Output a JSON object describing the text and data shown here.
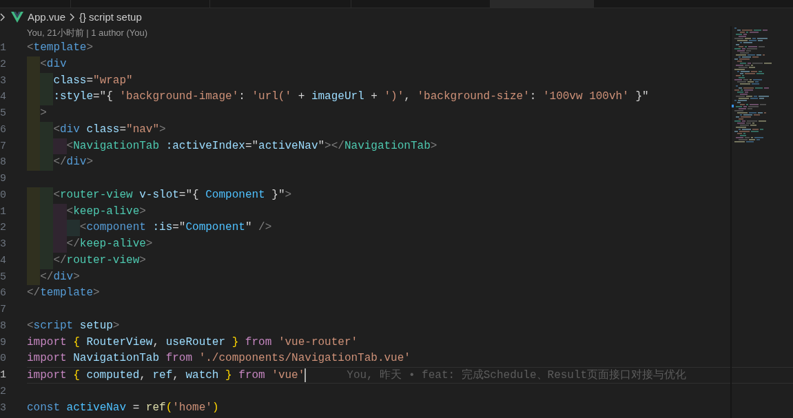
{
  "tabs": [
    {
      "selected": false
    },
    {
      "selected": false
    },
    {
      "selected": false
    },
    {
      "selected": false
    },
    {
      "selected": true
    }
  ],
  "breadcrumb": [
    {
      "kind": "file",
      "label": "App.vue"
    },
    {
      "kind": "symbol",
      "icon": "{}",
      "label": "script setup"
    }
  ],
  "codelens": "You, 21小时前 | 1 author (You)",
  "lines": [
    {
      "number": "1",
      "current": false,
      "tokens": [
        {
          "kind": "p",
          "text": "<"
        },
        {
          "kind": "tag",
          "text": "template"
        },
        {
          "kind": "p",
          "text": ">"
        }
      ],
      "children": [
        {
          "number": "2",
          "current": false,
          "tokens": [
            {
              "kind": "p",
              "text": "<"
            },
            {
              "kind": "tag",
              "text": "div"
            }
          ],
          "children": [
            {
              "number": "3",
              "current": false,
              "tokens": [
                {
                  "kind": "attr",
                  "text": "class"
                },
                {
                  "kind": "op",
                  "text": "="
                },
                {
                  "kind": "str",
                  "text": "\"wrap\""
                }
              ]
            },
            {
              "number": "4",
              "current": false,
              "tokens": [
                {
                  "kind": "attr",
                  "text": ":style"
                },
                {
                  "kind": "op",
                  "text": "=\"{ "
                },
                {
                  "kind": "str",
                  "text": "'background-image'"
                },
                {
                  "kind": "op",
                  "text": ": "
                },
                {
                  "kind": "str",
                  "text": "'url('"
                },
                {
                  "kind": "op",
                  "text": " + "
                },
                {
                  "kind": "var",
                  "text": "imageUrl"
                },
                {
                  "kind": "op",
                  "text": " + "
                },
                {
                  "kind": "str",
                  "text": "')'"
                },
                {
                  "kind": "op",
                  "text": ", "
                },
                {
                  "kind": "str",
                  "text": "'background-size'"
                },
                {
                  "kind": "op",
                  "text": ": "
                },
                {
                  "kind": "str",
                  "text": "'100vw 100vh'"
                },
                {
                  "kind": "op",
                  "text": " }\""
                }
              ]
            }
          ]
        },
        {
          "number": "5",
          "current": false,
          "tokens": [
            {
              "kind": "p",
              "text": ">"
            }
          ],
          "children": [
            {
              "number": "6",
              "current": false,
              "tokens": [
                {
                  "kind": "p",
                  "text": "<"
                },
                {
                  "kind": "tag",
                  "text": "div"
                },
                {
                  "kind": "attr",
                  "text": " class"
                },
                {
                  "kind": "op",
                  "text": "="
                },
                {
                  "kind": "str",
                  "text": "\"nav\""
                },
                {
                  "kind": "p",
                  "text": ">"
                }
              ],
              "children": [
                {
                  "number": "7",
                  "current": false,
                  "tokens": [
                    {
                      "kind": "p",
                      "text": "<"
                    },
                    {
                      "kind": "comp",
                      "text": "NavigationTab"
                    },
                    {
                      "kind": "attr",
                      "text": " :activeIndex"
                    },
                    {
                      "kind": "op",
                      "text": "=\""
                    },
                    {
                      "kind": "var",
                      "text": "activeNav"
                    },
                    {
                      "kind": "op",
                      "text": "\""
                    },
                    {
                      "kind": "p",
                      "text": "></"
                    },
                    {
                      "kind": "comp",
                      "text": "NavigationTab"
                    },
                    {
                      "kind": "p",
                      "text": ">"
                    }
                  ]
                }
              ]
            },
            {
              "number": "8",
              "current": false,
              "tokens": [
                {
                  "kind": "p",
                  "text": "</"
                },
                {
                  "kind": "tag",
                  "text": "div"
                },
                {
                  "kind": "p",
                  "text": ">"
                }
              ]
            },
            {
              "number": "9",
              "current": false
            },
            {
              "number": "0",
              "current": false,
              "tokens": [
                {
                  "kind": "p",
                  "text": "<"
                },
                {
                  "kind": "comp",
                  "text": "router-view"
                },
                {
                  "kind": "attr",
                  "text": " v-slot"
                },
                {
                  "kind": "op",
                  "text": "=\"{ "
                },
                {
                  "kind": "cls",
                  "text": "Component"
                },
                {
                  "kind": "op",
                  "text": " }\""
                },
                {
                  "kind": "p",
                  "text": ">"
                }
              ],
              "children": [
                {
                  "number": "1",
                  "current": false,
                  "tokens": [
                    {
                      "kind": "p",
                      "text": "<"
                    },
                    {
                      "kind": "comp",
                      "text": "keep-alive"
                    },
                    {
                      "kind": "p",
                      "text": ">"
                    }
                  ],
                  "children": [
                    {
                      "number": "2",
                      "current": false,
                      "tokens": [
                        {
                          "kind": "p",
                          "text": "<"
                        },
                        {
                          "kind": "tag",
                          "text": "component"
                        },
                        {
                          "kind": "attr",
                          "text": " :is"
                        },
                        {
                          "kind": "op",
                          "text": "=\""
                        },
                        {
                          "kind": "cls",
                          "text": "Component"
                        },
                        {
                          "kind": "op",
                          "text": "\""
                        },
                        {
                          "kind": "p",
                          "text": " />"
                        }
                      ]
                    }
                  ]
                },
                {
                  "number": "3",
                  "current": false,
                  "tokens": [
                    {
                      "kind": "p",
                      "text": "</"
                    },
                    {
                      "kind": "comp",
                      "text": "keep-alive"
                    },
                    {
                      "kind": "p",
                      "text": ">"
                    }
                  ]
                }
              ]
            },
            {
              "number": "4",
              "current": false,
              "tokens": [
                {
                  "kind": "p",
                  "text": "</"
                },
                {
                  "kind": "comp",
                  "text": "router-view"
                },
                {
                  "kind": "p",
                  "text": ">"
                }
              ]
            }
          ]
        },
        {
          "number": "5",
          "current": false,
          "tokens": [
            {
              "kind": "p",
              "text": "</"
            },
            {
              "kind": "tag",
              "text": "div"
            },
            {
              "kind": "p",
              "text": ">"
            }
          ]
        }
      ]
    },
    {
      "number": "6",
      "current": false,
      "tokens": [
        {
          "kind": "p",
          "text": "</"
        },
        {
          "kind": "tag",
          "text": "template"
        },
        {
          "kind": "p",
          "text": ">"
        }
      ]
    },
    {
      "number": "7",
      "current": false
    },
    {
      "number": "8",
      "current": false,
      "tokens": [
        {
          "kind": "p",
          "text": "<"
        },
        {
          "kind": "tag",
          "text": "script"
        },
        {
          "kind": "attr",
          "text": " setup"
        },
        {
          "kind": "p",
          "text": ">"
        }
      ]
    },
    {
      "number": "9",
      "current": false,
      "tokens": [
        {
          "kind": "kw",
          "text": "import"
        },
        {
          "kind": "brace",
          "text": " {"
        },
        {
          "kind": "var",
          "text": " RouterView"
        },
        {
          "kind": "op",
          "text": ", "
        },
        {
          "kind": "var",
          "text": "useRouter"
        },
        {
          "kind": "brace",
          "text": " }"
        },
        {
          "kind": "kw",
          "text": " from"
        },
        {
          "kind": "str",
          "text": " 'vue-router'"
        }
      ]
    },
    {
      "number": "0",
      "current": false,
      "tokens": [
        {
          "kind": "kw",
          "text": "import"
        },
        {
          "kind": "var",
          "text": " NavigationTab"
        },
        {
          "kind": "kw",
          "text": " from"
        },
        {
          "kind": "str",
          "text": " './components/NavigationTab.vue'"
        }
      ]
    },
    {
      "number": "1",
      "current": true,
      "blame": "You, 昨天 • feat: 完成Schedule、Result页面接口对接与优化",
      "tokens": [
        {
          "kind": "kw",
          "text": "import"
        },
        {
          "kind": "brace",
          "text": " {"
        },
        {
          "kind": "var",
          "text": " computed"
        },
        {
          "kind": "op",
          "text": ", "
        },
        {
          "kind": "var",
          "text": "ref"
        },
        {
          "kind": "op",
          "text": ", "
        },
        {
          "kind": "var",
          "text": "watch"
        },
        {
          "kind": "brace",
          "text": " }"
        },
        {
          "kind": "kw",
          "text": " from"
        },
        {
          "kind": "str",
          "text": " 'vue'"
        }
      ]
    },
    {
      "number": "2",
      "current": false
    },
    {
      "number": "3",
      "current": false,
      "tokens": [
        {
          "kind": "const",
          "text": "const"
        },
        {
          "kind": "cls",
          "text": " activeNav"
        },
        {
          "kind": "op",
          "text": " = "
        },
        {
          "kind": "fn",
          "text": "ref"
        },
        {
          "kind": "brace",
          "text": "("
        },
        {
          "kind": "str",
          "text": "'home'"
        },
        {
          "kind": "brace",
          "text": ")"
        }
      ]
    }
  ]
}
